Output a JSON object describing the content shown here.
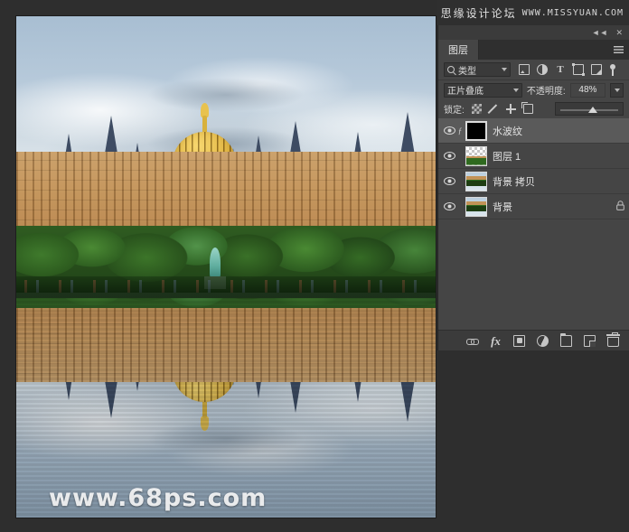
{
  "watermarks": {
    "forum_cn": "思缘设计论坛",
    "forum_url": "WWW.MISSYUAN.COM",
    "canvas": "www.68ps.com"
  },
  "panel": {
    "collapse_icon": "◄◄",
    "close_icon": "✕",
    "tab_label": "图层",
    "menu_icon": "panel-menu-icon",
    "filter": {
      "search_icon": "search-icon",
      "kind_label": "类型",
      "kind_caret": "chevron-down-icon",
      "icons": [
        {
          "name": "filter-pixel-icon",
          "title": "像素图层"
        },
        {
          "name": "filter-adjustment-icon",
          "title": "调整图层"
        },
        {
          "name": "filter-type-icon",
          "title": "T"
        },
        {
          "name": "filter-shape-icon",
          "title": "形状图层"
        },
        {
          "name": "filter-smart-object-icon",
          "title": "智能对象"
        },
        {
          "name": "filter-toggle-icon",
          "title": "打开/关闭筛选"
        }
      ]
    },
    "blend": {
      "mode_label": "正片叠底",
      "mode_caret": "chevron-down-icon",
      "opacity_label": "不透明度:",
      "opacity_value": "48%",
      "opacity_caret": "chevron-down-icon"
    },
    "lock": {
      "label": "锁定:",
      "items": [
        {
          "name": "lock-transparent-pixels-icon"
        },
        {
          "name": "lock-image-pixels-icon"
        },
        {
          "name": "lock-position-icon"
        },
        {
          "name": "lock-artboard-icon"
        }
      ],
      "fill_slider": "fill-slider"
    },
    "layers": [
      {
        "name": "水波纹",
        "visible": true,
        "selected": true,
        "thumb": "mask",
        "has_fx": true,
        "locked": false
      },
      {
        "name": "图层 1",
        "visible": true,
        "selected": false,
        "thumb": "checker",
        "has_fx": false,
        "locked": false
      },
      {
        "name": "背景 拷贝",
        "visible": true,
        "selected": false,
        "thumb": "photo",
        "has_fx": false,
        "locked": false
      },
      {
        "name": "背景",
        "visible": true,
        "selected": false,
        "thumb": "photo",
        "has_fx": false,
        "locked": true,
        "lock_icon": "🔒"
      }
    ],
    "footer": [
      {
        "name": "link-layers-icon"
      },
      {
        "name": "layer-style-fx-icon"
      },
      {
        "name": "add-layer-mask-icon"
      },
      {
        "name": "new-adjustment-layer-icon"
      },
      {
        "name": "new-group-icon"
      },
      {
        "name": "new-layer-icon"
      },
      {
        "name": "delete-layer-icon"
      }
    ]
  },
  "colors": {
    "panel_bg": "#3b3b3b",
    "row_bg": "#454545",
    "row_selected": "#5a5a5a",
    "app_bg": "#2e2e2e",
    "text": "#e2e2e2"
  }
}
